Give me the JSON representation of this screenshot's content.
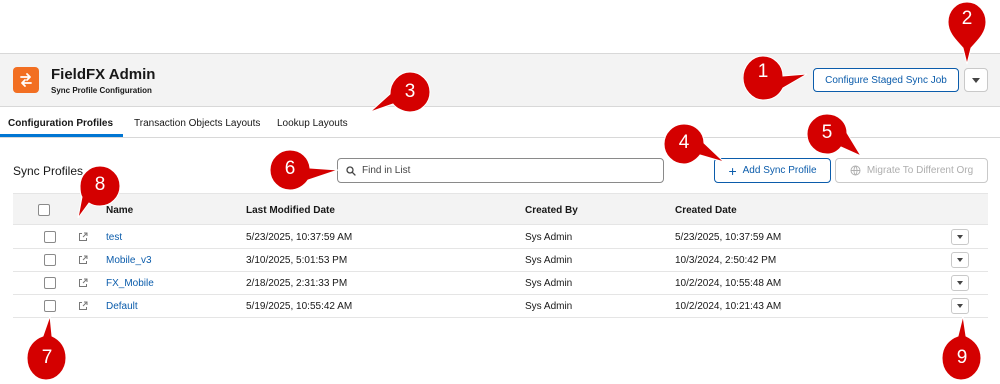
{
  "header": {
    "app_title": "FieldFX Admin",
    "app_subtitle": "Sync Profile Configuration",
    "configure_button": "Configure Staged Sync Job",
    "logo_icon": "sync-arrows-icon",
    "logo_color": "#f26f22"
  },
  "tabs": [
    {
      "label": "Configuration Profiles",
      "active": true
    },
    {
      "label": "Transaction Objects Layouts",
      "active": false
    },
    {
      "label": "Lookup Layouts",
      "active": false
    }
  ],
  "toolbar": {
    "section_title": "Sync Profiles",
    "search_placeholder": "Find in List",
    "add_button": "Add Sync Profile",
    "migrate_button": "Migrate To Different Org"
  },
  "table": {
    "columns": [
      "Name",
      "Last Modified Date",
      "Created By",
      "Created Date"
    ],
    "rows": [
      {
        "name": "test",
        "last_modified": "5/23/2025, 10:37:59 AM",
        "created_by": "Sys Admin",
        "created_date": "5/23/2025, 10:37:59 AM"
      },
      {
        "name": "Mobile_v3",
        "last_modified": "3/10/2025, 5:01:53 PM",
        "created_by": "Sys Admin",
        "created_date": "10/3/2024, 2:50:42 PM"
      },
      {
        "name": "FX_Mobile",
        "last_modified": "2/18/2025, 2:31:33 PM",
        "created_by": "Sys Admin",
        "created_date": "10/2/2024, 10:55:48 AM"
      },
      {
        "name": "Default",
        "last_modified": "5/19/2025, 10:55:42 AM",
        "created_by": "Sys Admin",
        "created_date": "10/2/2024, 10:21:43 AM"
      }
    ]
  },
  "callouts": [
    "1",
    "2",
    "3",
    "4",
    "5",
    "6",
    "7",
    "8",
    "9"
  ],
  "colors": {
    "accent": "#0176d3",
    "link": "#0b5cab",
    "callout": "#d40000"
  }
}
